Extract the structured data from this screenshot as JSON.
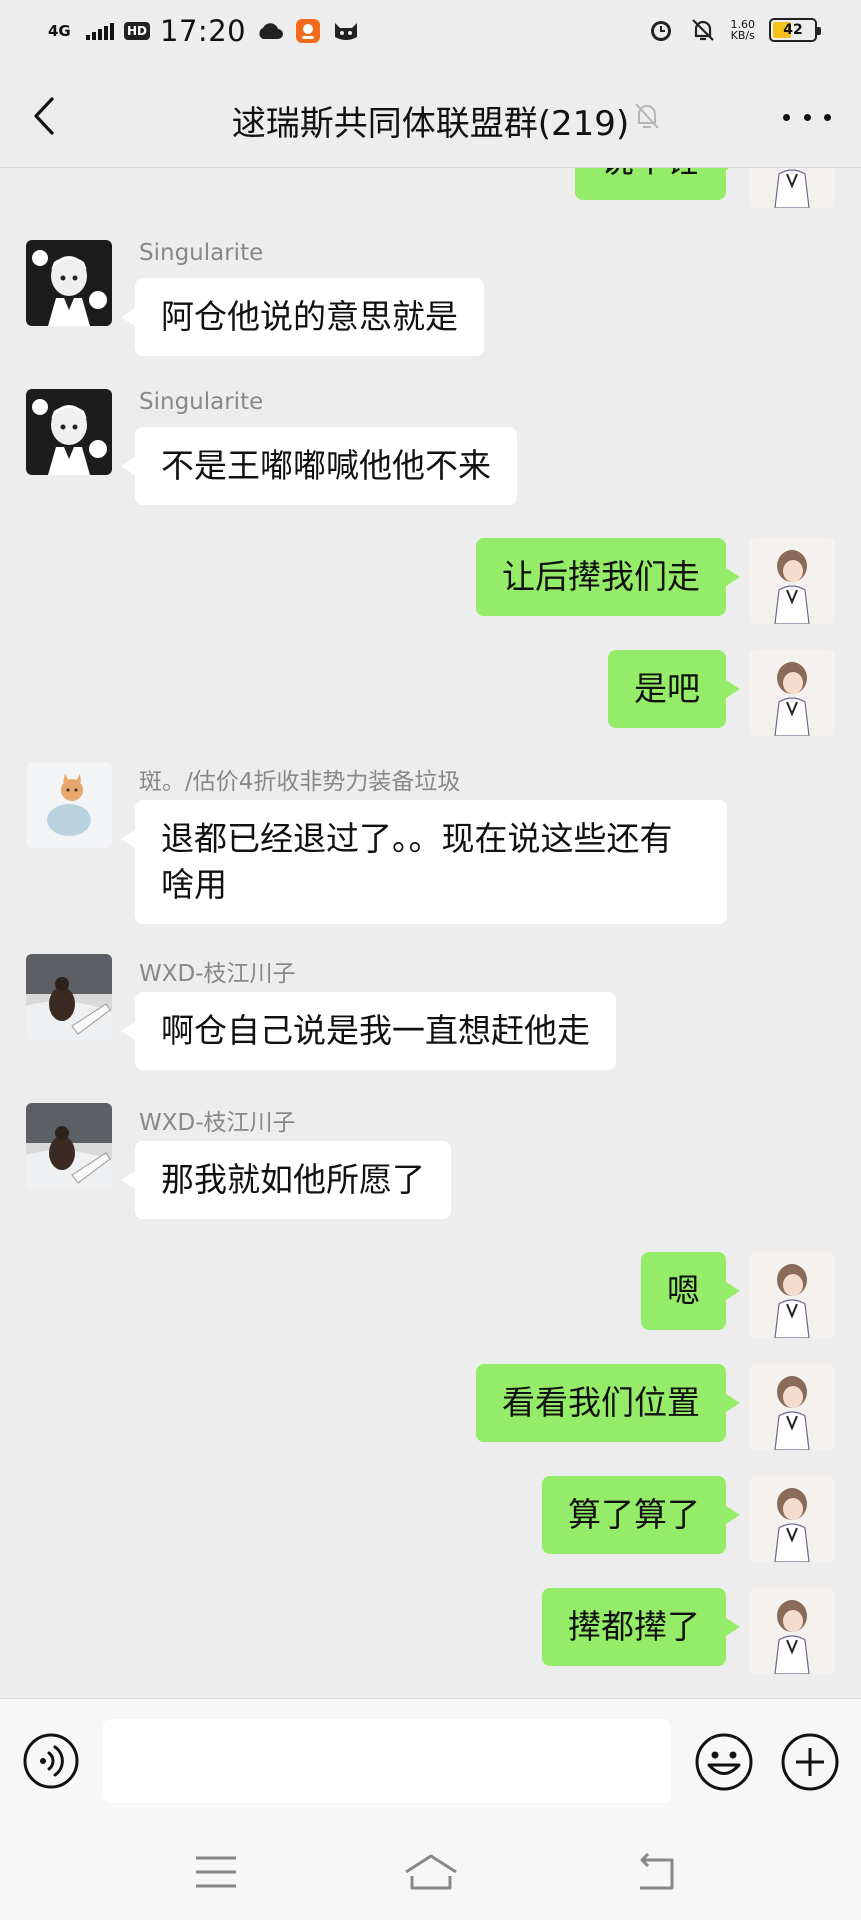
{
  "status_bar": {
    "network": "4G",
    "hd": "HD",
    "time": "17:20",
    "speed_value": "1.60",
    "speed_unit": "KB/s",
    "battery": "42"
  },
  "header": {
    "title": "逑瑞斯共同体联盟群(219)"
  },
  "messages": [
    {
      "side": "out",
      "text": "说个锤"
    },
    {
      "side": "in",
      "sender": "Singularite",
      "text": "阿仓他说的意思就是"
    },
    {
      "side": "in",
      "sender": "Singularite",
      "text": "不是王嘟嘟喊他他不来"
    },
    {
      "side": "out",
      "text": "让后撵我们走"
    },
    {
      "side": "out",
      "text": "是吧"
    },
    {
      "side": "in",
      "sender": "斑。/估价4折收非势力装备垃圾",
      "text": "退都已经退过了。。现在说这些还有啥用"
    },
    {
      "side": "in",
      "sender": "WXD-枝江川子",
      "text": "啊仓自己说是我一直想赶他走"
    },
    {
      "side": "in",
      "sender": "WXD-枝江川子",
      "text": "那我就如他所愿了"
    },
    {
      "side": "out",
      "text": "嗯"
    },
    {
      "side": "out",
      "text": "看看我们位置"
    },
    {
      "side": "out",
      "text": "算了算了"
    },
    {
      "side": "out",
      "text": "撵都撵了"
    }
  ],
  "input": {
    "placeholder": ""
  },
  "colors": {
    "background": "#ededed",
    "outgoing_bubble": "#95ec69",
    "incoming_bubble": "#ffffff",
    "sender_name": "#888888"
  }
}
